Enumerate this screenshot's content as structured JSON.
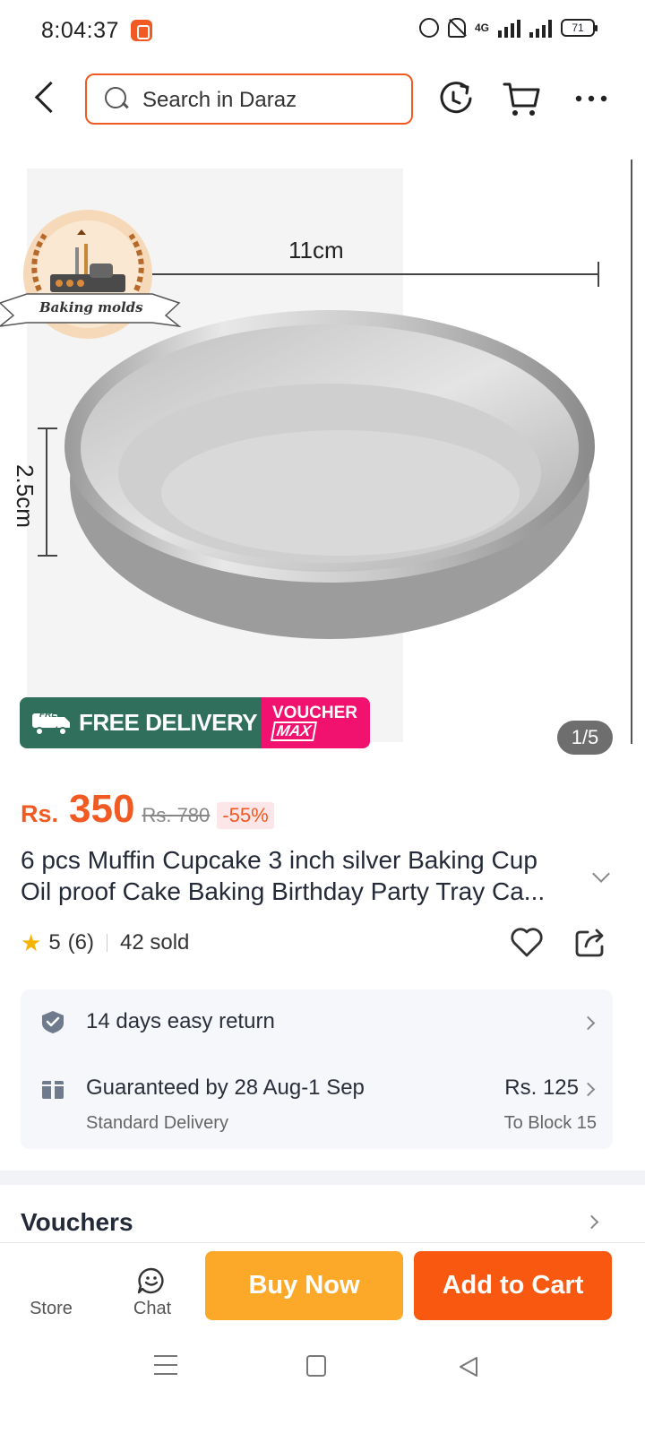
{
  "status_bar": {
    "time": "8:04:37",
    "network": "4G",
    "battery": "71"
  },
  "top_nav": {
    "search_placeholder": "Search in Daraz",
    "icons": [
      "back-arrow-icon",
      "search-icon",
      "refresh-icon",
      "cart-icon",
      "more-icon"
    ]
  },
  "gallery": {
    "logo_text": "Baking molds",
    "dim_width": "11cm",
    "dim_height": "2.5cm",
    "counter": "1/5",
    "promo_free_delivery": "FREE DELIVERY",
    "promo_free_tag": "FREE",
    "promo_voucher": "VOUCHER",
    "promo_max": "MAX"
  },
  "price": {
    "currency": "Rs.",
    "current": "350",
    "original": "Rs. 780",
    "discount": "-55%"
  },
  "product": {
    "title_line1": "6 pcs Muffin Cupcake 3 inch silver Baking Cup",
    "title_line2": "Oil proof Cake Baking Birthday Party Tray Ca..."
  },
  "rating": {
    "score": "5",
    "count": "(6)",
    "sold": "42 sold"
  },
  "services": {
    "return_text": "14 days easy return",
    "delivery_text": "Guaranteed by 28 Aug-1 Sep",
    "delivery_sub": "Standard Delivery",
    "delivery_price": "Rs. 125",
    "delivery_to": "To Block 15"
  },
  "vouchers": {
    "title": "Vouchers"
  },
  "action_bar": {
    "store_label": "Store",
    "chat_label": "Chat",
    "buy_now": "Buy Now",
    "add_to_cart": "Add to Cart"
  },
  "colors": {
    "brand_orange": "#f15a22",
    "buy_now": "#fca92a",
    "add_to_cart": "#f8580f",
    "free_delivery_green": "#2f6f5c",
    "voucher_pink": "#f0126e"
  }
}
